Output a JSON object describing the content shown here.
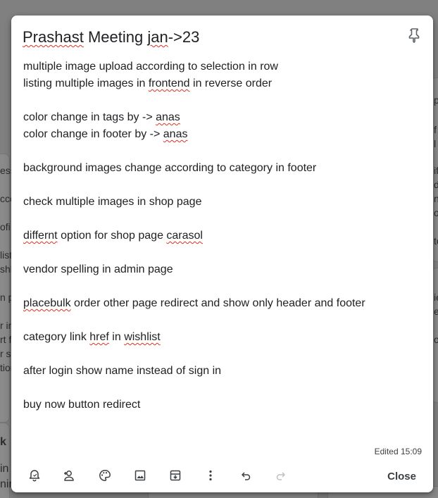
{
  "background": {
    "left_fragments": [
      "ess",
      "cco",
      "ofi",
      "list",
      "shl",
      "n p",
      "r in",
      "rt f",
      "r se",
      "tion",
      "k",
      "in",
      "nin"
    ],
    "right_fragments": [
      "p",
      "f",
      "l",
      "if",
      "de",
      "n",
      "o",
      "to",
      "ie",
      "er",
      "o"
    ]
  },
  "note": {
    "title_words": [
      {
        "text": "Prashast",
        "spell": true
      },
      {
        "text": " Meeting ",
        "spell": false
      },
      {
        "text": "jan",
        "spell": true
      },
      {
        "text": "->23",
        "spell": false
      }
    ],
    "lines": [
      [
        {
          "text": "multiple image upload according to selection in row",
          "spell": false
        }
      ],
      [
        {
          "text": "listing multiple images in ",
          "spell": false
        },
        {
          "text": "frontend",
          "spell": true
        },
        {
          "text": " in reverse order",
          "spell": false
        }
      ],
      [],
      [
        {
          "text": "color change in tags by -> ",
          "spell": false
        },
        {
          "text": "anas",
          "spell": true
        }
      ],
      [
        {
          "text": "color change in footer by -> ",
          "spell": false
        },
        {
          "text": "anas",
          "spell": true
        }
      ],
      [],
      [
        {
          "text": "background images change according to category in footer",
          "spell": false
        }
      ],
      [],
      [
        {
          "text": "check multiple images in shop page",
          "spell": false
        }
      ],
      [],
      [
        {
          "text": "differnt",
          "spell": true
        },
        {
          "text": " option for shop page ",
          "spell": false
        },
        {
          "text": "carasol",
          "spell": true
        }
      ],
      [],
      [
        {
          "text": "vendor spelling in admin page",
          "spell": false
        }
      ],
      [],
      [
        {
          "text": "placebulk",
          "spell": true
        },
        {
          "text": " order other page redirect and show only header and footer",
          "spell": false
        }
      ],
      [],
      [
        {
          "text": "category link ",
          "spell": false
        },
        {
          "text": "href",
          "spell": true
        },
        {
          "text": " in ",
          "spell": false
        },
        {
          "text": "wishlist",
          "spell": true
        }
      ],
      [],
      [
        {
          "text": "after login show name instead of sign in",
          "spell": false
        }
      ],
      [],
      [
        {
          "text": "buy now button redirect",
          "spell": false
        }
      ]
    ],
    "edited_label": "Edited 15:09",
    "close_label": "Close"
  },
  "toolbar": {
    "icons": [
      "remind-me-icon",
      "collaborator-icon",
      "palette-icon",
      "image-icon",
      "archive-icon",
      "more-icon",
      "undo-icon",
      "redo-icon"
    ]
  },
  "colors": {
    "text": "#202124",
    "icon": "#3c4043",
    "disabled_icon": "#bdc1c6",
    "spell_underline": "#d93025",
    "backdrop": "#808080"
  }
}
